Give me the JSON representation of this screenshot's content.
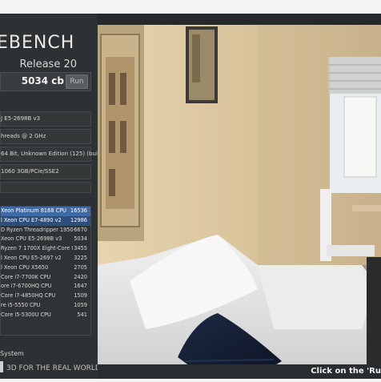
{
  "app": {
    "logo_title": "EBENCH",
    "logo_subtitle": "Release 20",
    "score": "5034 cb",
    "run_label": "Run",
    "footer_tagline": "3D FOR THE REAL WORLD",
    "system_label": "System",
    "status_text": "Click on the 'Ru"
  },
  "system_info": {
    "cpu": "J E5-2698B v3",
    "threads": "hreads @ 2 GHz",
    "os": "64 Bit, Unknown Edition (125) (bui",
    "gpu": "1060 3GB/PCIe/SSE2"
  },
  "ranking": [
    {
      "name": "Xeon Platinum 8168 CPU",
      "score": "16536"
    },
    {
      "name": "l Xeon CPU E7-4890 v2",
      "score": "12986"
    },
    {
      "name": "D Ryzen Threadripper 1950",
      "score": "6670"
    },
    {
      "name": "Xeon CPU E5-2698B v3",
      "score": "5034"
    },
    {
      "name": "Ryzen 7 1700X Eight-Core I",
      "score": "3455"
    },
    {
      "name": "l Xeon CPU E5-2697 v2",
      "score": "3225"
    },
    {
      "name": "l Xeon CPU X5650",
      "score": "2705"
    },
    {
      "name": "Core i7-7700K CPU",
      "score": "2420"
    },
    {
      "name": "ore i7-6700HQ CPU",
      "score": "1647"
    },
    {
      "name": "Core i7-4850HQ CPU",
      "score": "1509"
    },
    {
      "name": "re i5-5550 CPU",
      "score": "1059"
    },
    {
      "name": "Core i5-5300U CPU",
      "score": "541"
    }
  ],
  "colors": {
    "accent": "#3f6aa8",
    "panel": "#2e3133"
  }
}
